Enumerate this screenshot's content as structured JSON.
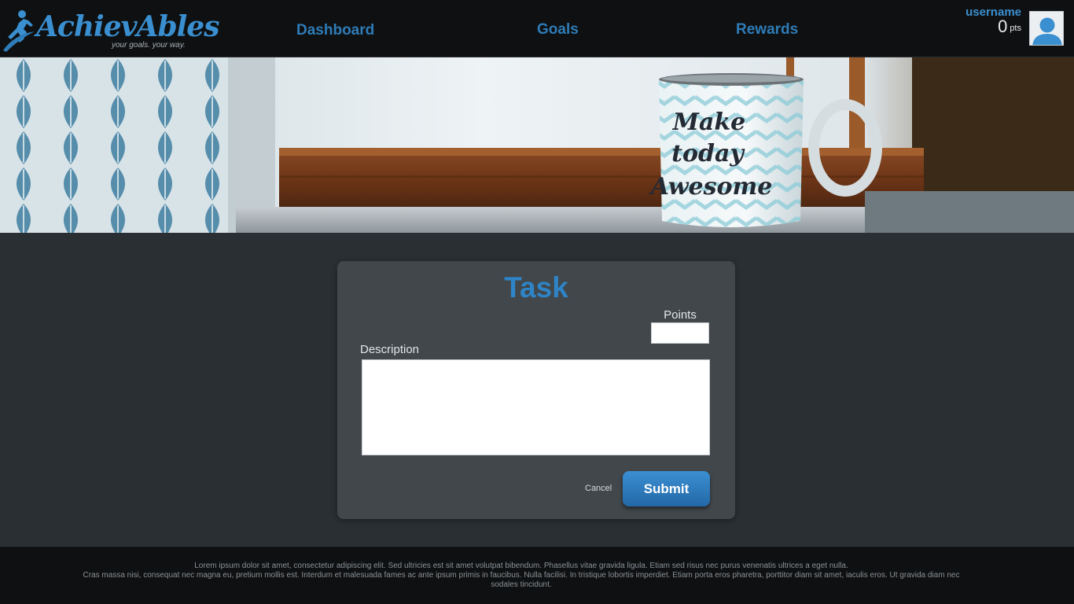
{
  "header": {
    "logo_text": "AchievAbles",
    "logo_tagline": "your goals. your way.",
    "nav": [
      {
        "label": "Dashboard"
      },
      {
        "label": "Goals"
      },
      {
        "label": "Rewards"
      }
    ],
    "user": {
      "name": "username",
      "points": "0",
      "points_unit": "pts"
    }
  },
  "banner": {
    "mug_text": [
      "Make",
      "today",
      "Awesome"
    ]
  },
  "form": {
    "title": "Task",
    "points_label": "Points",
    "points_value": "",
    "description_label": "Description",
    "description_value": "",
    "cancel_label": "Cancel",
    "submit_label": "Submit"
  },
  "footer": {
    "line1": "Lorem ipsum dolor sit amet, consectetur adipiscing elit. Sed ultricies est sit amet volutpat bibendum. Phasellus vitae gravida ligula. Etiam sed risus nec purus venenatis ultrices a eget nulla.",
    "line2": "Cras massa nisi, consequat nec magna eu, pretium mollis est. Interdum et malesuada fames ac ante ipsum primis in faucibus. Nulla facilisi. In tristique lobortis imperdiet. Etiam porta eros pharetra, porttitor diam sit amet, iaculis eros. Ut gravida diam nec sodales tincidunt."
  },
  "colors": {
    "accent": "#2e84c6",
    "header_bg": "#0f1011",
    "page_bg": "#2a2f33",
    "card_bg": "#41474b"
  },
  "icons": {
    "logo": "runner-logo-icon",
    "avatar": "user-avatar-icon"
  }
}
